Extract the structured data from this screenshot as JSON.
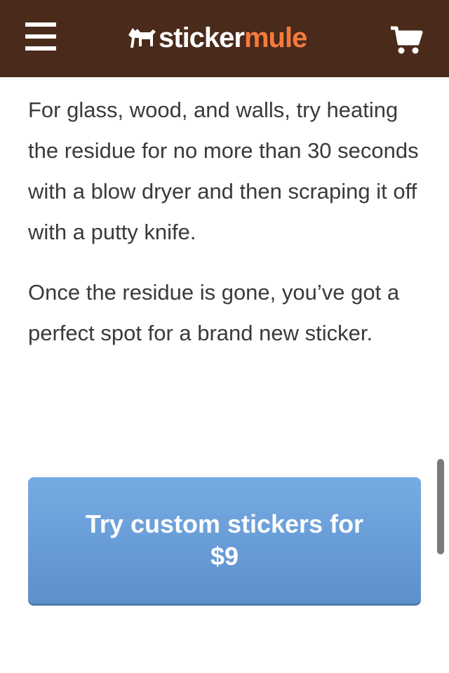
{
  "header": {
    "logo_part1": "sticker",
    "logo_part2": "mule",
    "background_color": "#4a2a1a",
    "accent_color": "#f47b3d",
    "menu_icon": "hamburger-menu-icon",
    "cart_icon": "shopping-cart-icon"
  },
  "content": {
    "paragraphs": [
      "For glass, wood, and walls, try heating the residue for no more than 30 seconds with a blow dryer and then scraping it off with a putty knife.",
      "Once the residue is gone, you’ve got a perfect spot for a brand new sticker."
    ]
  },
  "cta": {
    "label": "Try custom stickers for $9",
    "color": "#6a9fd9"
  }
}
